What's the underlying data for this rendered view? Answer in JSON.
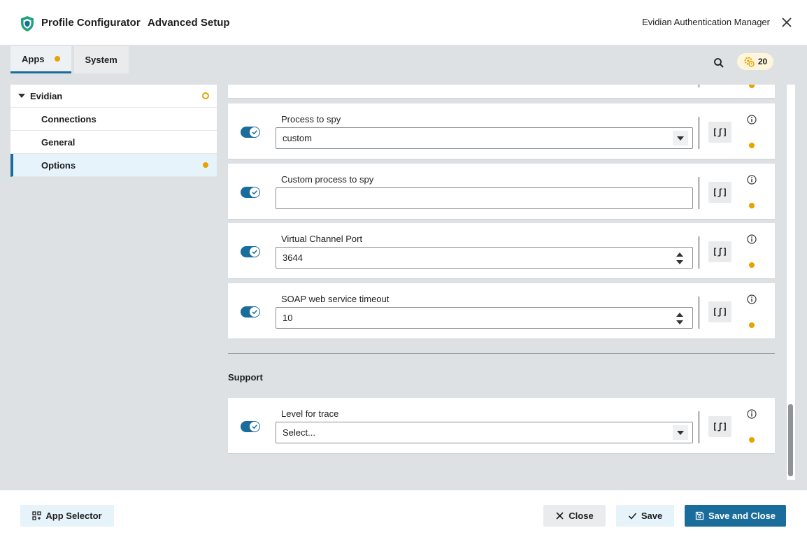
{
  "header": {
    "app_name": "Profile Configurator",
    "page_title": "Advanced Setup",
    "product_name": "Evidian Authentication Manager"
  },
  "tabs": [
    {
      "label": "Apps",
      "active": true,
      "modified": true
    },
    {
      "label": "System",
      "active": false,
      "modified": false
    }
  ],
  "badge": {
    "count": "20"
  },
  "tree": {
    "parent": {
      "label": "Evidian"
    },
    "children": [
      {
        "label": "Connections"
      },
      {
        "label": "General"
      },
      {
        "label": "Options",
        "selected": true,
        "modified": true
      }
    ]
  },
  "settings": [
    {
      "label": "Process to spy",
      "type": "select",
      "value": "custom",
      "enabled": true
    },
    {
      "label": "Custom process to spy",
      "type": "text",
      "value": "",
      "enabled": true
    },
    {
      "label": "Virtual Channel Port",
      "type": "number",
      "value": "3644",
      "enabled": true
    },
    {
      "label": "SOAP web service timeout",
      "type": "number",
      "value": "10",
      "enabled": true
    }
  ],
  "support": {
    "title": "Support",
    "settings": [
      {
        "label": "Level for trace",
        "type": "select",
        "value": "Select...",
        "enabled": true
      }
    ]
  },
  "expression_button_label": "[ʃ]",
  "footer": {
    "app_selector": "App Selector",
    "close": "Close",
    "save": "Save",
    "save_and_close": "Save and Close"
  },
  "colors": {
    "primary": "#1a6c9b",
    "modified_dot": "#e8a300",
    "background": "#dde1e4"
  }
}
